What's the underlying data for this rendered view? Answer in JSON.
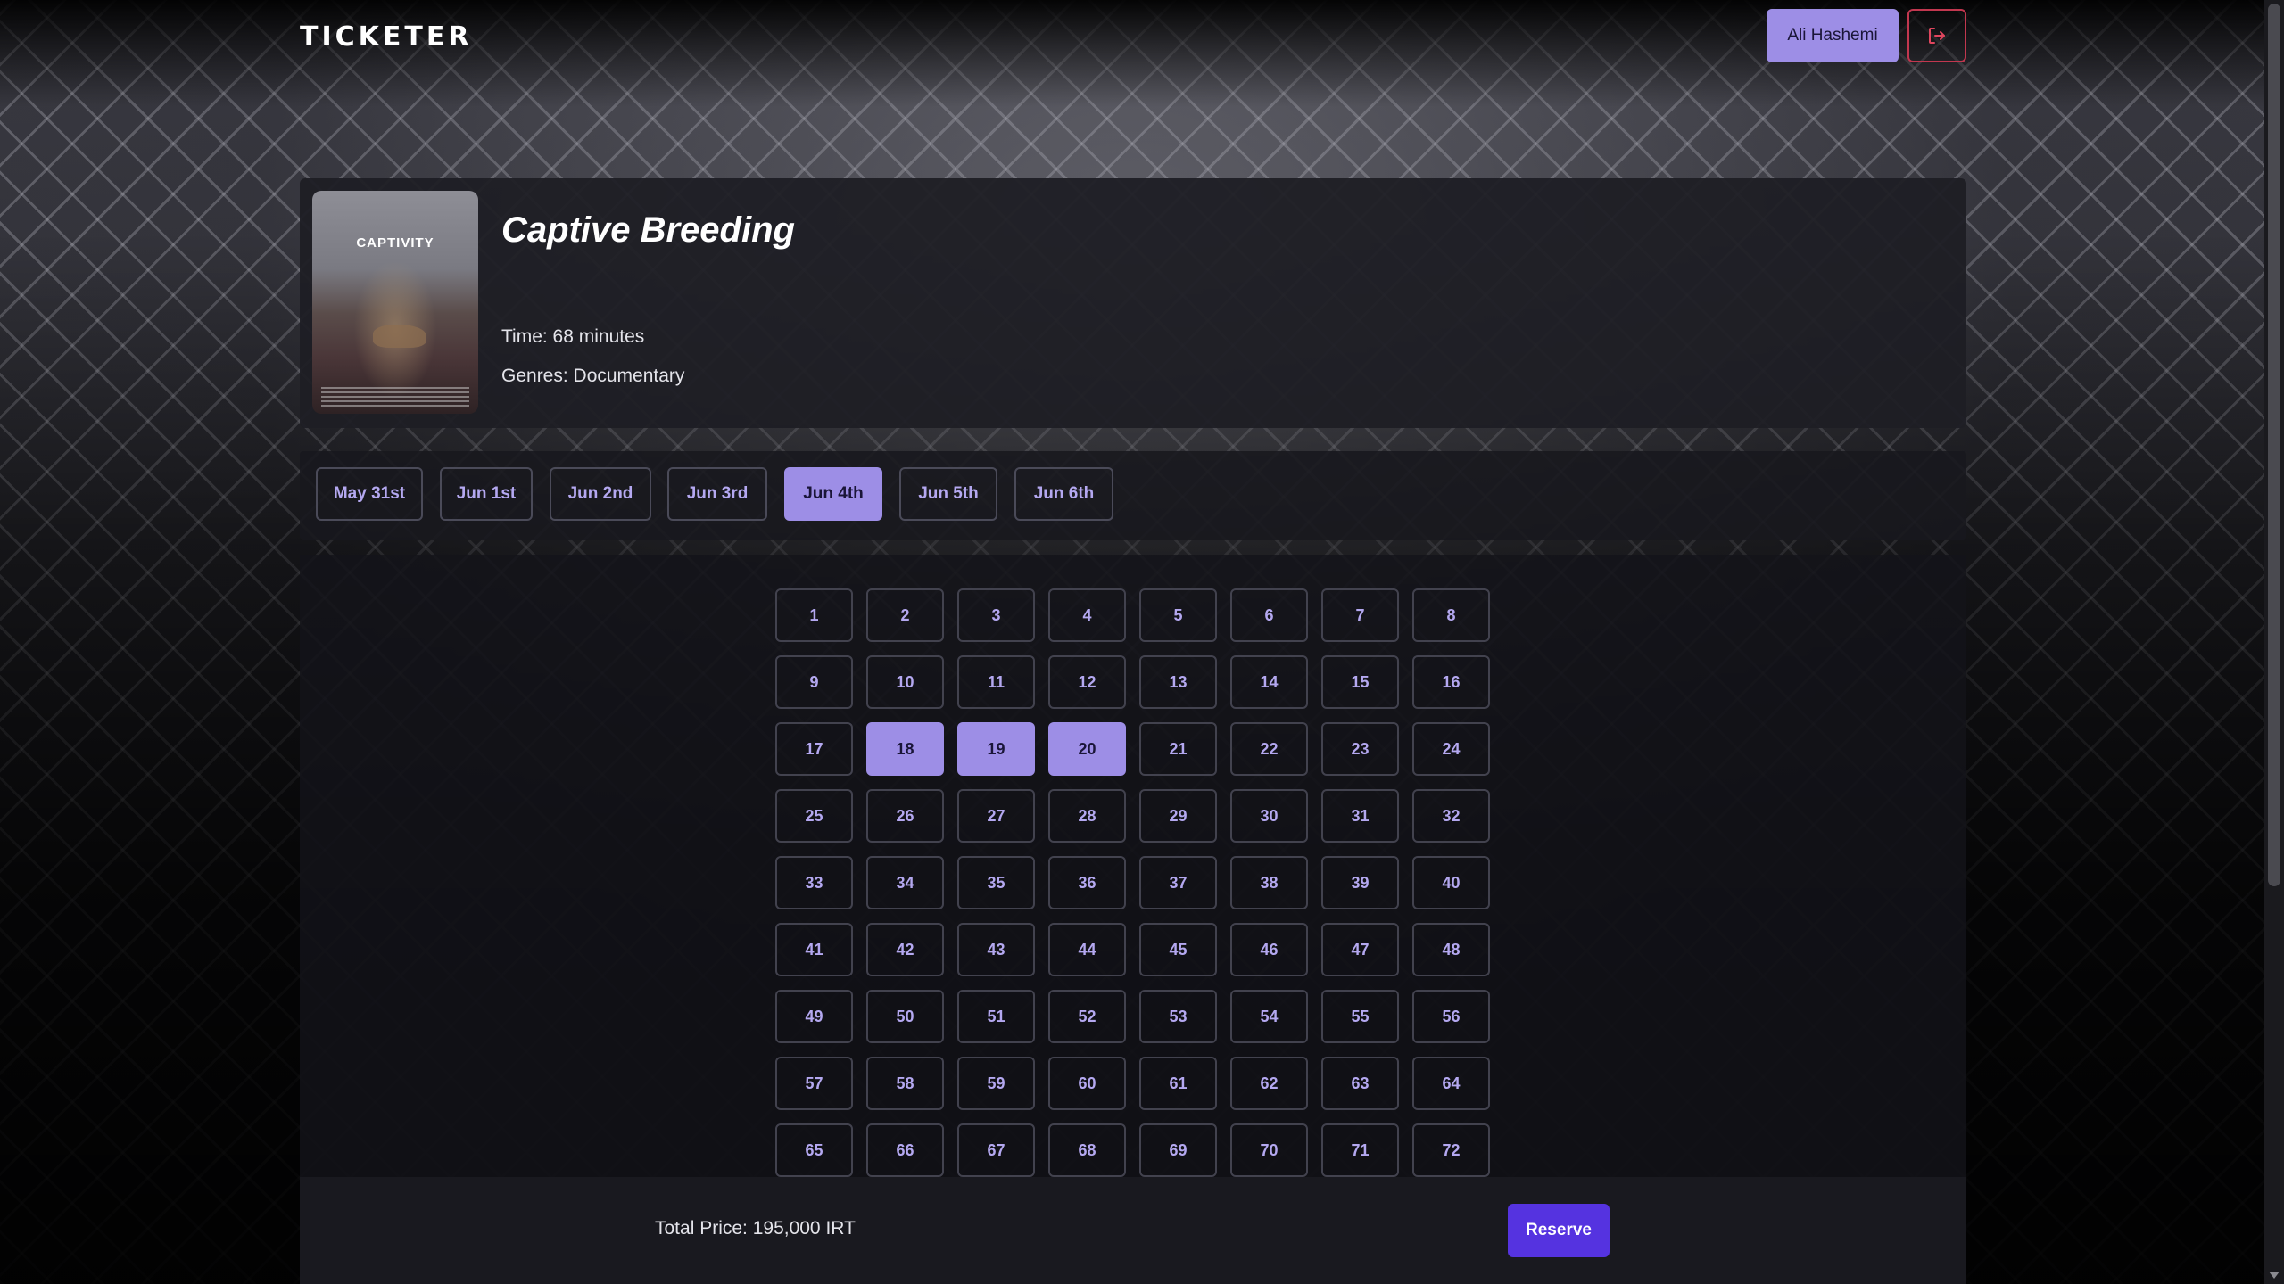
{
  "header": {
    "logo": "TICKETER",
    "user_name": "Ali Hashemi"
  },
  "movie": {
    "title": "Captive Breeding",
    "time": "Time: 68 minutes",
    "genres": "Genres: Documentary",
    "poster_title": "CAPTIVITY"
  },
  "dates": [
    {
      "label": "May 31st",
      "active": false
    },
    {
      "label": "Jun 1st",
      "active": false
    },
    {
      "label": "Jun 2nd",
      "active": false
    },
    {
      "label": "Jun 3rd",
      "active": false
    },
    {
      "label": "Jun 4th",
      "active": true
    },
    {
      "label": "Jun 5th",
      "active": false
    },
    {
      "label": "Jun 6th",
      "active": false
    }
  ],
  "seats": {
    "count": 72,
    "selected": [
      18,
      19,
      20
    ]
  },
  "footer": {
    "total_price": "Total Price: 195,000 IRT",
    "reserve_label": "Reserve"
  },
  "colors": {
    "accent": "#9d8ee6",
    "primary_button": "#5533e0",
    "logout_border": "#c2374f"
  }
}
